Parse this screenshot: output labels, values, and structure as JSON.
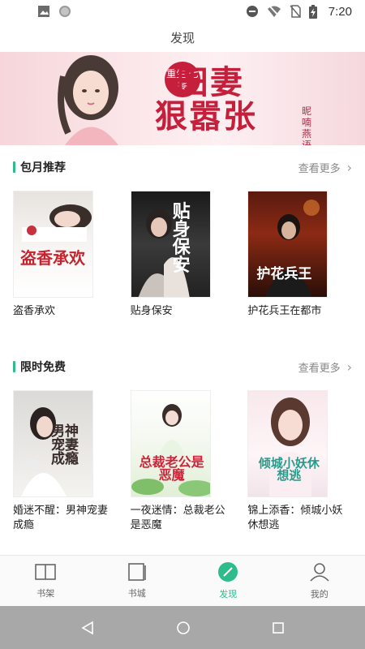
{
  "status_bar": {
    "time": "7:20"
  },
  "header": {
    "title": "发现"
  },
  "banner": {
    "badge": "重生 七零",
    "title_line1": "田妻",
    "title_line2": "狠嚣张",
    "author": "昵喃燕语"
  },
  "sections": [
    {
      "title": "包月推荐",
      "more_label": "查看更多",
      "books": [
        {
          "title": "盗香承欢",
          "cover_text": "盗香承欢"
        },
        {
          "title": "贴身保安",
          "cover_text": "贴身保安"
        },
        {
          "title": "护花兵王在都市",
          "cover_text": "护花兵王"
        }
      ]
    },
    {
      "title": "限时免费",
      "more_label": "查看更多",
      "books": [
        {
          "title": "婚迷不醒：男神宠妻成瘾",
          "cover_text": "男神宠妻成瘾"
        },
        {
          "title": "一夜迷情：总裁老公是恶魔",
          "cover_text": "总裁老公是恶魔"
        },
        {
          "title": "锦上添香：倾城小妖休想逃",
          "cover_text": "倾城小妖休想逃"
        }
      ]
    }
  ],
  "tabbar": {
    "items": [
      {
        "label": "书架",
        "icon": "book-open-icon",
        "active": false
      },
      {
        "label": "书城",
        "icon": "book-icon",
        "active": false
      },
      {
        "label": "发现",
        "icon": "discover-icon",
        "active": true
      },
      {
        "label": "我的",
        "icon": "user-icon",
        "active": false
      }
    ]
  },
  "colors": {
    "accent": "#2ebc8c",
    "banner_title": "#c51f3b"
  }
}
